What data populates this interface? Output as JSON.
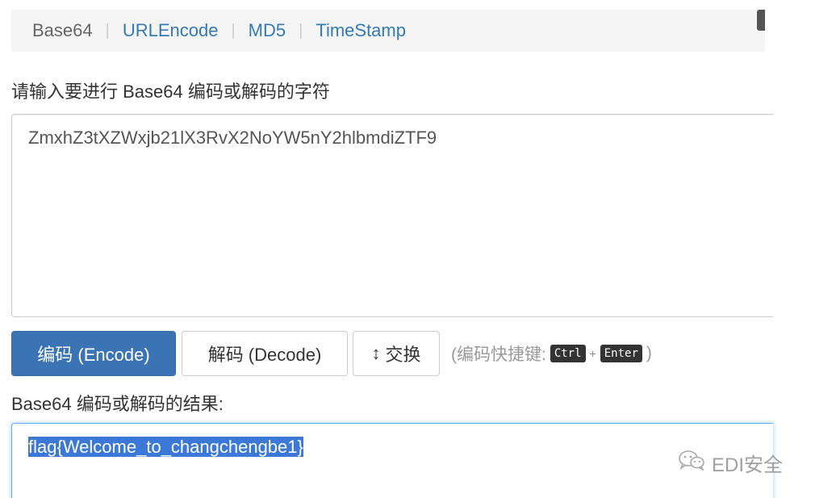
{
  "nav": {
    "tabs": [
      {
        "label": "Base64"
      },
      {
        "label": "URLEncode"
      },
      {
        "label": "MD5"
      },
      {
        "label": "TimeStamp"
      }
    ],
    "separator": "|"
  },
  "input": {
    "label": "请输入要进行 Base64 编码或解码的字符",
    "value": "ZmxhZ3tXZWxjb21lX3RvX2NoYW5nY2hlbmdiZTF9"
  },
  "buttons": {
    "encode": "编码 (Encode)",
    "decode": "解码 (Decode)",
    "swap_icon": "↕",
    "swap": "交换"
  },
  "hint": {
    "prefix": "(编码快捷键:",
    "key1": "Ctrl",
    "plus": "+",
    "key2": "Enter",
    "suffix": ")"
  },
  "output": {
    "label": "Base64 编码或解码的结果:",
    "value": "flag{Welcome_to_changchengbe1}"
  },
  "watermark": {
    "icon": "wechat-icon",
    "text": "EDI安全"
  },
  "colors": {
    "link": "#337ab7",
    "primary_button": "#3a74b5",
    "selection": "#3b78d8"
  }
}
